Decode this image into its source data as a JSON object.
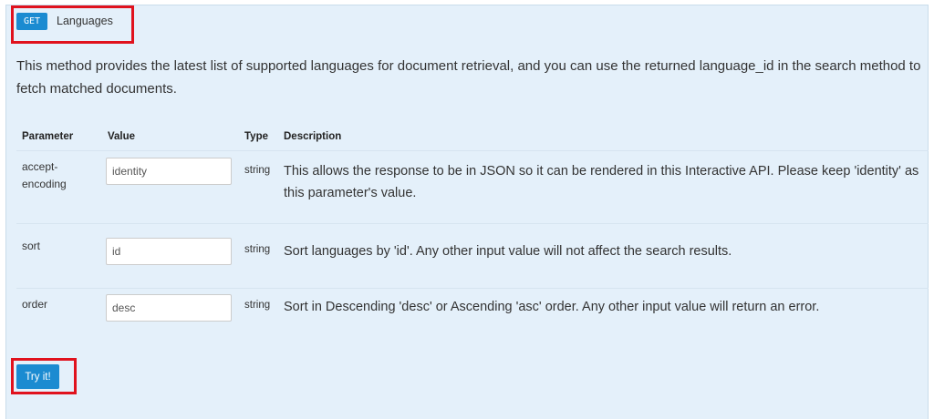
{
  "endpoint": {
    "method": "GET",
    "name": "Languages",
    "description": "This method provides the latest list of supported languages for document retrieval, and you can use the returned language_id in the search method to fetch matched documents."
  },
  "table": {
    "headers": {
      "parameter": "Parameter",
      "value": "Value",
      "type": "Type",
      "description": "Description"
    },
    "rows": [
      {
        "parameter": "accept-encoding",
        "value": "identity",
        "type": "string",
        "description": "This allows the response to be in JSON so it can be rendered in this Interactive API. Please keep 'identity' as this parameter's value."
      },
      {
        "parameter": "sort",
        "value": "id",
        "type": "string",
        "description": "Sort languages by 'id'. Any other input value will not affect the search results."
      },
      {
        "parameter": "order",
        "value": "desc",
        "type": "string",
        "description": "Sort in Descending 'desc' or Ascending 'asc' order. Any other input value will return an error."
      }
    ]
  },
  "actions": {
    "try_label": "Try it!"
  },
  "colors": {
    "panel_bg": "#e4f0fa",
    "accent": "#1b8bd1",
    "highlight": "#e0121d"
  }
}
